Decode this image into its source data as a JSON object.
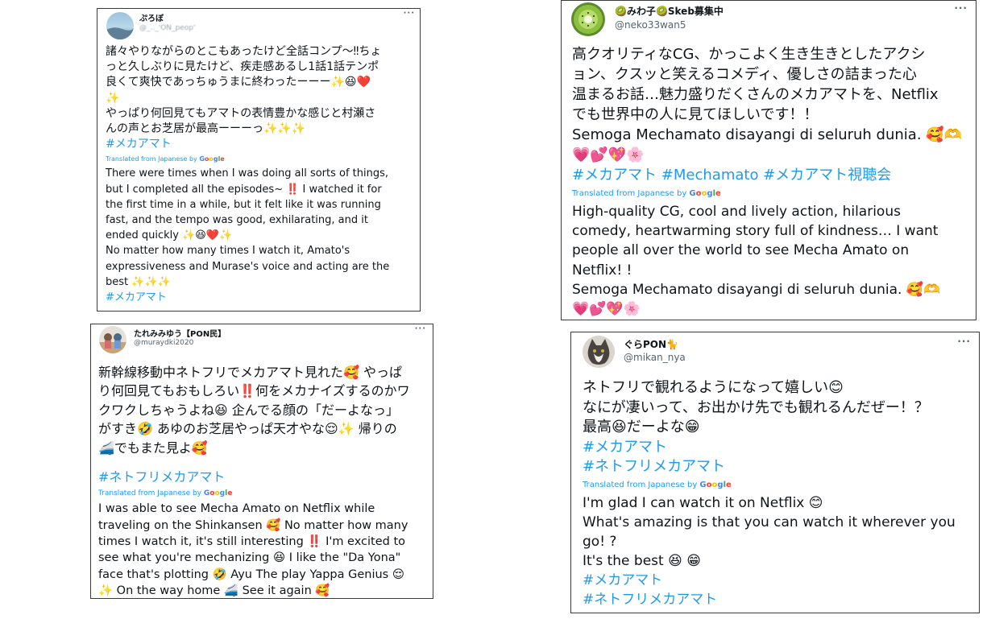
{
  "translated_label": "Translated from Japanese by",
  "google_letters": [
    "G",
    "o",
    "o",
    "g",
    "l",
    "e"
  ],
  "tweets": [
    {
      "user": "ぷろぼ",
      "handle": "@_.._'ON_peop'",
      "more": "···",
      "jp_lines": [
        "諸々やりながらのとこもあったけど全話コンプ〜‼ちょ",
        "っと久しぶりに見たけど、疾走感あるし1話1話テンポ",
        "良くて爽快であっちゅうまに終わったーーー✨😆❤️",
        "✨",
        "やっぱり何回見てもアマトの表情豊かな感じと村瀬さ",
        "んの声とお芝居が最高ーーーっ✨✨✨"
      ],
      "jp_tags": [
        "#メカアマト"
      ],
      "en_lines": [
        "There were times when I was doing all sorts of things,",
        "but I completed all the episodes~ ‼️ I watched it for",
        "the first time in a while, but it felt like it was running",
        "fast, and the tempo was good, exhilarating, and it",
        "ended quickly ✨😆❤️✨",
        "No matter how many times I watch it, Amato's",
        "expressiveness and Murase's voice and acting are the",
        "best ✨✨✨"
      ],
      "en_tags": [
        "#メカアマト"
      ]
    },
    {
      "user": "🥝みわ子🥝Skeb募集中",
      "handle": "@neko33wan5",
      "more": "···",
      "jp_lines": [
        "高クオリティなCG、かっこよく生き生きとしたアクシ",
        "ョン、クスッと笑えるコメディ、優しさの詰まった心",
        "温まるお話…魅力盛りだくさんのメカアマトを、Netflix",
        "でも世界中の人に見てほしいです！！",
        "Semoga Mechamato disayangi di seluruh dunia. 🥰🫶",
        "💗💕💖🌸"
      ],
      "jp_tags": [
        "#メカアマト #Mechamato #メカアマト視聴会"
      ],
      "en_lines": [
        "High-quality CG, cool and lively action, hilarious",
        "comedy, heartwarming story full of kindness… I want",
        "people all over the world to see Mecha Amato on",
        "Netflix! !",
        "Semoga Mechamato disayangi di seluruh dunia. 🥰🫶",
        "💗💕💖🌸"
      ],
      "en_tags": []
    },
    {
      "user": "たれみみゆう【PON民】",
      "handle": "@muraydki2020",
      "more": "···",
      "jp_lines": [
        "新幹線移動中ネトフリでメカアマト見れた🥰 やっぱ",
        "り何回見てもおもしろい‼️何をメカナイズするのかワ",
        "クワクしちゃうよね😆 企んでる顔の「だーよなっ」",
        "がすき🤣 あゆのお芝居やっぱ天才やな😌✨ 帰りの",
        "🚄でもまた見よ🥰"
      ],
      "jp_tags": [
        "#ネトフリメカアマト"
      ],
      "en_lines": [
        "I was able to see Mecha Amato on Netflix while",
        "traveling on the Shinkansen 🥰 No matter how many",
        "times I watch it, it's still interesting ‼️ I'm excited to",
        "see what you're mechanizing 😆 I like the \"Da Yona\"",
        "face that's plotting 🤣 Ayu The play Yappa Genius 😌",
        "✨ On the way home 🚄 See it again 🥰"
      ],
      "en_tags": []
    },
    {
      "user": "ぐらPON🐈",
      "handle": "@mikan_nya",
      "more": "···",
      "jp_lines": [
        "ネトフリで観れるようになって嬉しい😊",
        "なにが凄いって、お出かけ先でも観れるんだぜー！？",
        "最高😆だーよな😁"
      ],
      "jp_tags": [
        "#メカアマト",
        "#ネトフリメカアマト"
      ],
      "en_lines": [
        "I'm glad I can watch it on Netflix 😊",
        "What's amazing is that you can watch it wherever you",
        "go! ?",
        "It's the best 😆 😁"
      ],
      "en_tags": [
        "#メカアマト",
        "#ネトフリメカアマト"
      ]
    }
  ]
}
